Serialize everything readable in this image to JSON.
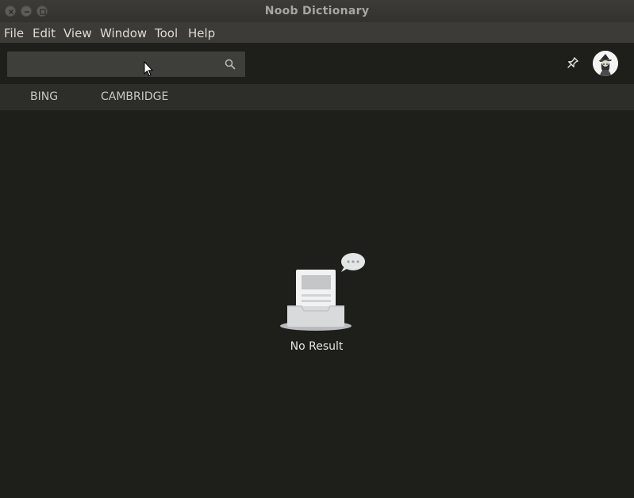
{
  "window": {
    "title": "Noob Dictionary"
  },
  "menu": {
    "items": [
      "File",
      "Edit",
      "View",
      "Window",
      "Tool",
      "Help"
    ]
  },
  "search": {
    "value": "",
    "placeholder": ""
  },
  "tabs": [
    {
      "label": "BING"
    },
    {
      "label": "CAMBRIDGE"
    }
  ],
  "empty_state": {
    "text": "No Result"
  },
  "icons": {
    "search": "search-icon",
    "pin": "pin-icon",
    "avatar": "avatar",
    "illustration": "empty-inbox-illustration"
  },
  "colors": {
    "background": "#1e1e1b",
    "titlebar": "#3c3b37",
    "tab_bar": "#2d2d2a",
    "search_field": "#3e3e3a"
  }
}
